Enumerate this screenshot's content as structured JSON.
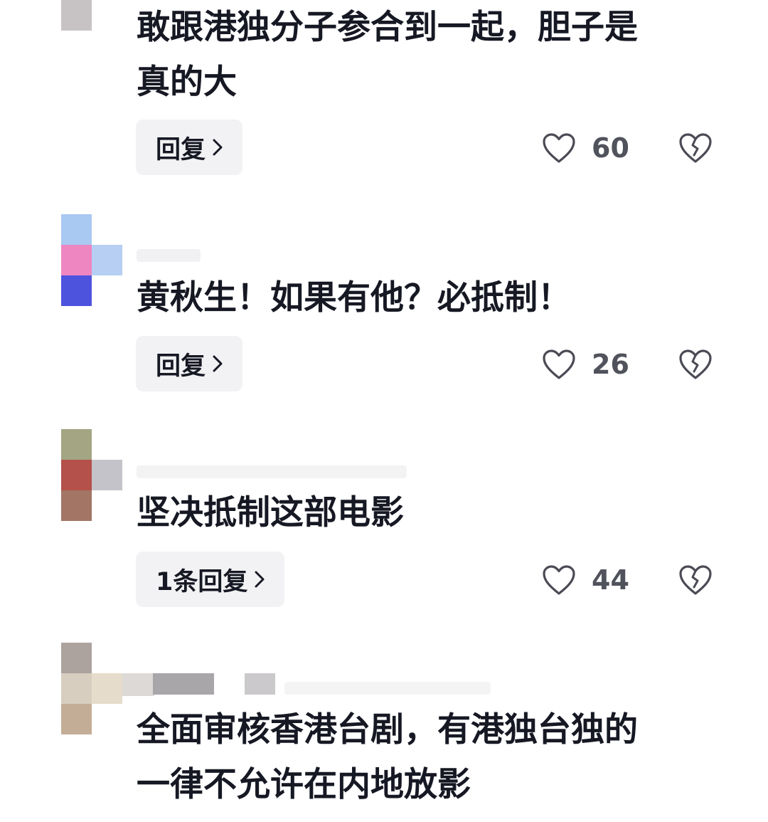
{
  "comments": [
    {
      "text": "敢跟港独分子参合到一起，胆子是\n真的大",
      "reply_label": "回复",
      "likes": "60"
    },
    {
      "text": "黄秋生！如果有他？必抵制！",
      "reply_label": "回复",
      "likes": "26"
    },
    {
      "text": "坚决抵制这部电影",
      "reply_label": "1条回复",
      "likes": "44"
    },
    {
      "text": "全面审核香港台剧，有港独台独的\n一律不允许在内地放影"
    }
  ],
  "icons": {
    "like": "heart-outline-icon",
    "dislike": "broken-heart-icon",
    "chevron": "chevron-right-icon"
  },
  "colors": {
    "text": "#161823",
    "secondary_text": "#50525c",
    "reply_bg": "#f2f2f4",
    "icon": "#4a4b54"
  }
}
